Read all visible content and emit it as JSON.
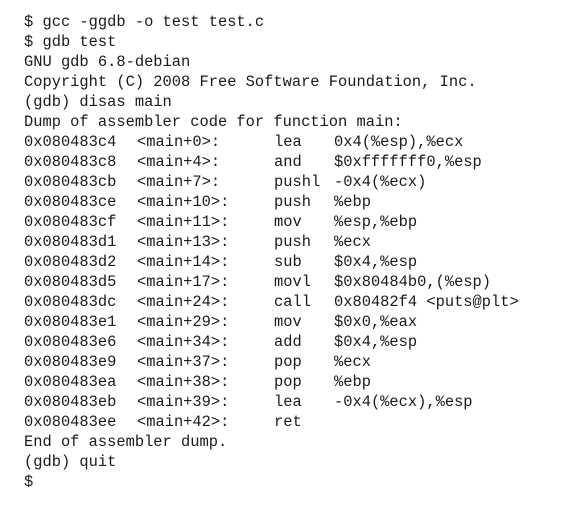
{
  "session_before": [
    "$ gcc -ggdb -o test test.c",
    "$ gdb test",
    "GNU gdb 6.8-debian",
    "Copyright (C) 2008 Free Software Foundation, Inc.",
    "(gdb) disas main",
    "Dump of assembler code for function main:"
  ],
  "disassembly": [
    {
      "addr": "0x080483c4",
      "label": "<main+0>:",
      "op": "lea",
      "args": "0x4(%esp),%ecx"
    },
    {
      "addr": "0x080483c8",
      "label": "<main+4>:",
      "op": "and",
      "args": "$0xfffffff0,%esp"
    },
    {
      "addr": "0x080483cb",
      "label": "<main+7>:",
      "op": "pushl",
      "args": "-0x4(%ecx)"
    },
    {
      "addr": "0x080483ce",
      "label": "<main+10>:",
      "op": "push",
      "args": "%ebp"
    },
    {
      "addr": "0x080483cf",
      "label": "<main+11>:",
      "op": "mov",
      "args": "%esp,%ebp"
    },
    {
      "addr": "0x080483d1",
      "label": "<main+13>:",
      "op": "push",
      "args": "%ecx"
    },
    {
      "addr": "0x080483d2",
      "label": "<main+14>:",
      "op": "sub",
      "args": "$0x4,%esp"
    },
    {
      "addr": "0x080483d5",
      "label": "<main+17>:",
      "op": "movl",
      "args": "$0x80484b0,(%esp)"
    },
    {
      "addr": "0x080483dc",
      "label": "<main+24>:",
      "op": "call",
      "args": "0x80482f4 <puts@plt>"
    },
    {
      "addr": "0x080483e1",
      "label": "<main+29>:",
      "op": "mov",
      "args": "$0x0,%eax"
    },
    {
      "addr": "0x080483e6",
      "label": "<main+34>:",
      "op": "add",
      "args": "$0x4,%esp"
    },
    {
      "addr": "0x080483e9",
      "label": "<main+37>:",
      "op": "pop",
      "args": "%ecx"
    },
    {
      "addr": "0x080483ea",
      "label": "<main+38>:",
      "op": "pop",
      "args": "%ebp"
    },
    {
      "addr": "0x080483eb",
      "label": "<main+39>:",
      "op": "lea",
      "args": "-0x4(%ecx),%esp"
    },
    {
      "addr": "0x080483ee",
      "label": "<main+42>:",
      "op": "ret",
      "args": ""
    }
  ],
  "session_after": [
    "End of assembler dump.",
    "(gdb) quit",
    "$"
  ]
}
